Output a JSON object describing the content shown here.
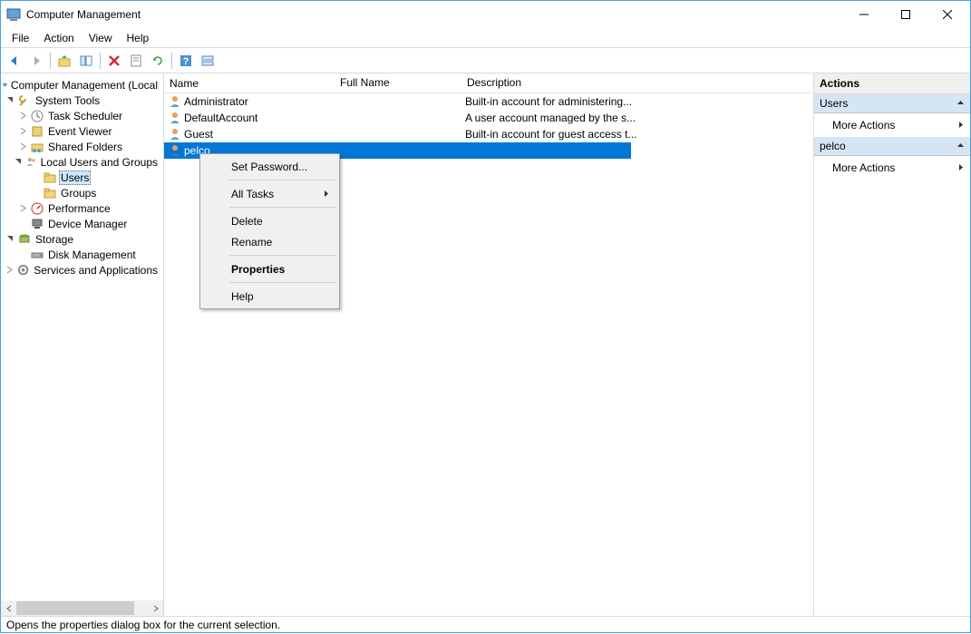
{
  "window": {
    "title": "Computer Management"
  },
  "menubar": {
    "file": "File",
    "action": "Action",
    "view": "View",
    "help": "Help"
  },
  "tree": {
    "root": "Computer Management (Local",
    "system_tools": "System Tools",
    "task_scheduler": "Task Scheduler",
    "event_viewer": "Event Viewer",
    "shared_folders": "Shared Folders",
    "local_users": "Local Users and Groups",
    "users": "Users",
    "groups": "Groups",
    "performance": "Performance",
    "device_manager": "Device Manager",
    "storage": "Storage",
    "disk_management": "Disk Management",
    "services_apps": "Services and Applications"
  },
  "list": {
    "columns": {
      "name": "Name",
      "full_name": "Full Name",
      "description": "Description"
    },
    "rows": [
      {
        "name": "Administrator",
        "full": "",
        "desc": "Built-in account for administering..."
      },
      {
        "name": "DefaultAccount",
        "full": "",
        "desc": "A user account managed by the s..."
      },
      {
        "name": "Guest",
        "full": "",
        "desc": "Built-in account for guest access t..."
      },
      {
        "name": "pelco",
        "full": "",
        "desc": ""
      }
    ]
  },
  "context_menu": {
    "set_password": "Set Password...",
    "all_tasks": "All Tasks",
    "delete": "Delete",
    "rename": "Rename",
    "properties": "Properties",
    "help": "Help"
  },
  "actions": {
    "header": "Actions",
    "section1": "Users",
    "more1": "More Actions",
    "section2": "pelco",
    "more2": "More Actions"
  },
  "statusbar": {
    "text": "Opens the properties dialog box for the current selection."
  }
}
